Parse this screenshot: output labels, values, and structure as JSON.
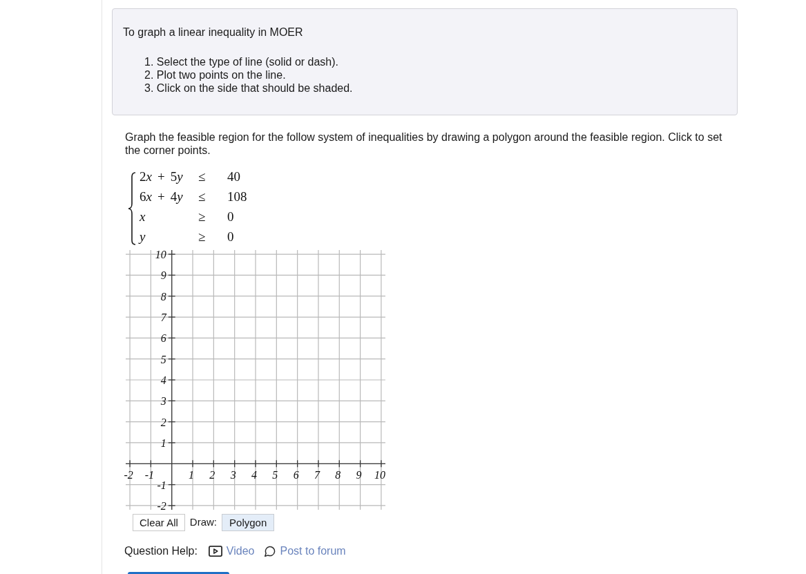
{
  "instructions": {
    "title": "To graph a linear inequality in MOER",
    "steps": [
      "1. Select the type of line (solid or dash).",
      "2. Plot two points on the line.",
      "3. Click on the side that should be shaded."
    ]
  },
  "question": {
    "prompt": "Graph the feasible region for the follow system of inequalities by drawing a polygon around the feasible region. Click to set the corner points.",
    "system": [
      {
        "lhs": [
          {
            "coefficient": "2",
            "variable": "x"
          },
          {
            "sign": "+",
            "coefficient": "5",
            "variable": "y"
          }
        ],
        "relation": "≤",
        "rhs": "40"
      },
      {
        "lhs": [
          {
            "coefficient": "6",
            "variable": "x"
          },
          {
            "sign": "+",
            "coefficient": "4",
            "variable": "y"
          }
        ],
        "relation": "≤",
        "rhs": "108"
      },
      {
        "lhs": [
          {
            "variable": "x"
          }
        ],
        "relation": "≥",
        "rhs": "0"
      },
      {
        "lhs": [
          {
            "variable": "y"
          }
        ],
        "relation": "≥",
        "rhs": "0"
      }
    ]
  },
  "graph": {
    "chart_data": {
      "type": "scatter",
      "xlim": [
        -2.2,
        10.2
      ],
      "ylim": [
        -2.2,
        10.2
      ],
      "xticks": [
        -2,
        -1,
        1,
        2,
        3,
        4,
        5,
        6,
        7,
        8,
        9,
        10
      ],
      "yticks": [
        10,
        9,
        8,
        7,
        6,
        5,
        4,
        3,
        2,
        1,
        -1,
        -2
      ],
      "grid": true
    }
  },
  "toolbar": {
    "clear_label": "Clear All",
    "draw_label": "Draw:",
    "draw_tools": [
      {
        "label": "Polygon",
        "selected": true
      }
    ]
  },
  "help": {
    "label": "Question Help:",
    "links": [
      {
        "kind": "video",
        "label": "Video"
      },
      {
        "kind": "forum",
        "label": "Post to forum"
      }
    ]
  }
}
